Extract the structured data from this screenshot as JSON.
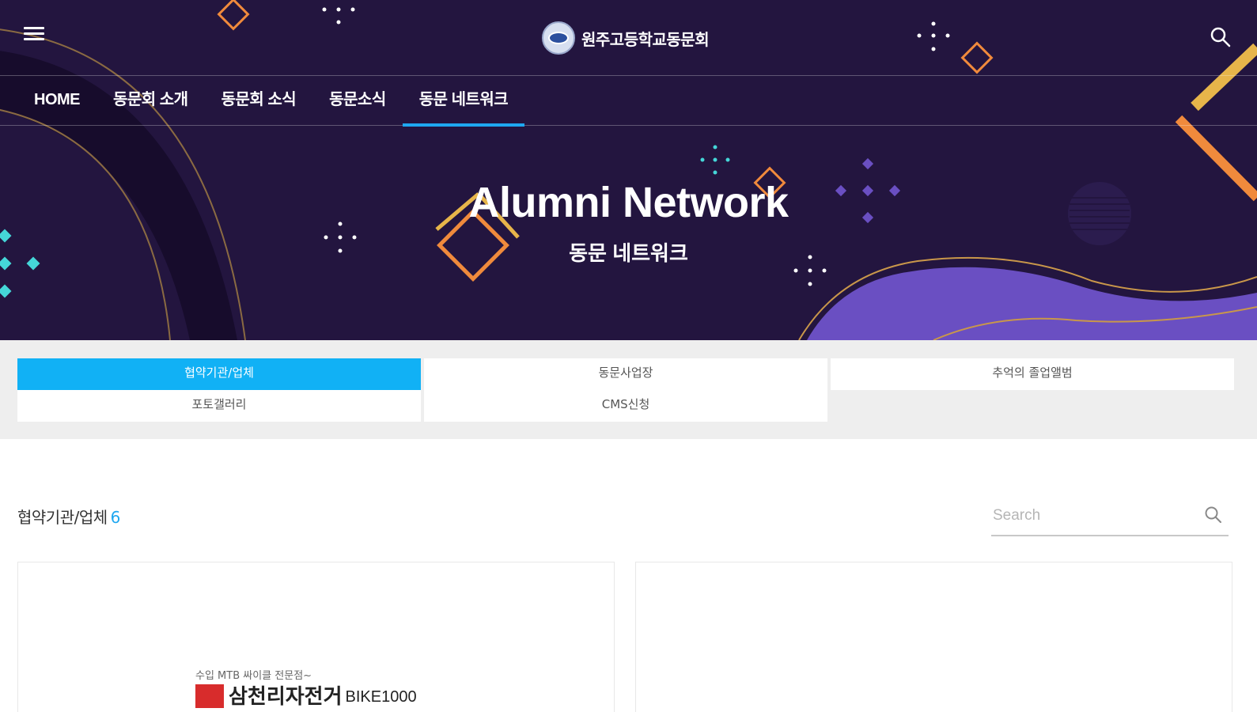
{
  "header": {
    "logo_text": "원주고등학교동문회",
    "nav": [
      {
        "label": "HOME"
      },
      {
        "label": "동문회 소개"
      },
      {
        "label": "동문회 소식"
      },
      {
        "label": "동문소식"
      },
      {
        "label": "동문 네트워크",
        "active": true
      }
    ]
  },
  "hero": {
    "title": "Alumni Network",
    "subtitle": "동문 네트워크"
  },
  "tabs": [
    {
      "label": "협약기관/업체",
      "active": true
    },
    {
      "label": "동문사업장"
    },
    {
      "label": "추억의 졸업앨범"
    },
    {
      "label": "포토갤러리"
    },
    {
      "label": "CMS신청"
    }
  ],
  "content": {
    "section_title": "협약기관/업체",
    "count": "6",
    "search_placeholder": "Search"
  },
  "cards": [
    {
      "subtitle": "수입 MTB 싸이클 전문점~",
      "name": "삼천리자전거",
      "name_en": "BIKE1000"
    },
    {}
  ],
  "colors": {
    "hero_bg": "#23153f",
    "accent_blue": "#11b1f5",
    "nav_underline": "#1ea7f0",
    "orange": "#f08a3c",
    "purple_wave": "#6a4fc2",
    "teal": "#45d6d8"
  },
  "icons": {
    "menu": "hamburger-menu-icon",
    "search": "search-icon"
  }
}
